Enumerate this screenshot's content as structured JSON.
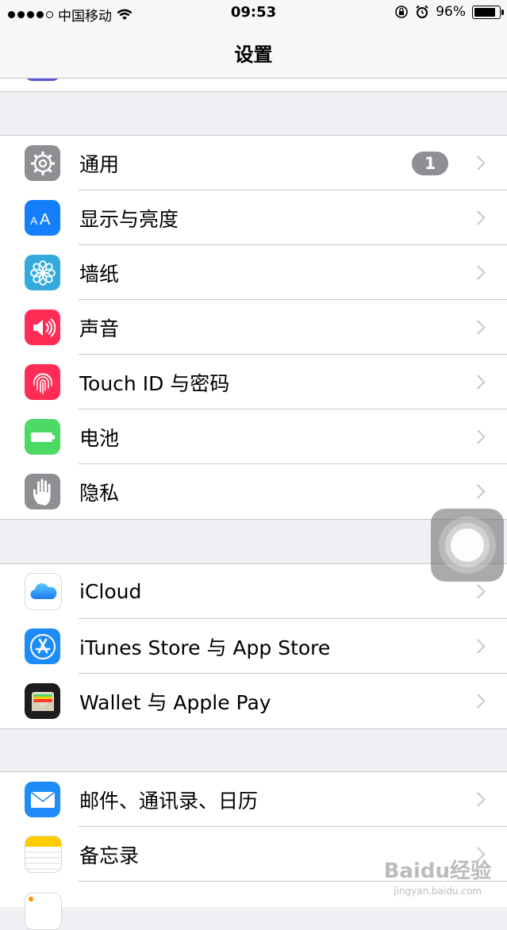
{
  "status_bar": {
    "carrier": "中国移动",
    "time": "09:53",
    "battery_percent": "96%",
    "battery_level": 0.96,
    "wifi_icon": "wifi-icon",
    "lock_rotation_icon": "rotation-lock-icon",
    "alarm_icon": "alarm-icon"
  },
  "nav": {
    "title": "设置"
  },
  "sections": [
    {
      "items": [
        {
          "label": "通用",
          "icon": "gear-icon",
          "color": "#8e8e93",
          "badge": "1"
        },
        {
          "label": "显示与亮度",
          "icon": "text-size-icon",
          "color": "#147efb"
        },
        {
          "label": "墙纸",
          "icon": "flower-icon",
          "color": "#34aadc"
        },
        {
          "label": "声音",
          "icon": "speaker-icon",
          "color": "#ff2d55"
        },
        {
          "label": "Touch ID 与密码",
          "icon": "fingerprint-icon",
          "color": "#ff2d55"
        },
        {
          "label": "电池",
          "icon": "battery-icon",
          "color": "#4cd964"
        },
        {
          "label": "隐私",
          "icon": "hand-icon",
          "color": "#8e8e93"
        }
      ]
    },
    {
      "items": [
        {
          "label": "iCloud",
          "icon": "cloud-icon",
          "color": "#ffffff"
        },
        {
          "label": "iTunes Store 与 App Store",
          "icon": "app-store-icon",
          "color": "#1d8cf8"
        },
        {
          "label": "Wallet 与 Apple Pay",
          "icon": "wallet-icon",
          "color": "#1c1c1e"
        }
      ]
    },
    {
      "items": [
        {
          "label": "邮件、通讯录、日历",
          "icon": "mail-icon",
          "color": "#1d8cf8"
        },
        {
          "label": "备忘录",
          "icon": "notes-icon",
          "color": "#ffffff"
        }
      ]
    }
  ],
  "watermark": {
    "text": "Baidu经验",
    "sub": "jingyan.baidu.com"
  }
}
